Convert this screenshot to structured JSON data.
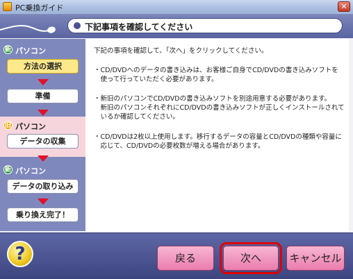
{
  "window": {
    "title": "PC乗換ガイド",
    "close_glyph": "✕"
  },
  "header": {
    "title": "下記事項を確認してください"
  },
  "sidebar": {
    "sections": [
      {
        "badge": "新",
        "label": "パソコン"
      },
      {
        "badge": "旧",
        "label": "パソコン"
      },
      {
        "badge": "新",
        "label": "パソコン"
      }
    ],
    "steps": [
      "方法の選択",
      "準備",
      "データの収集",
      "データの取り込み",
      "乗り換え完了！"
    ]
  },
  "main": {
    "paragraphs": [
      "下記の事項を確認して、「次へ」をクリックしてください。",
      "・CD/DVDへのデータの書き込みは、お客様ご自身でCD/DVDの書き込みソフトを\n　使って行っていただく必要があります。",
      "・新旧のパソコンでCD/DVDの書き込みソフトを別途用意する必要があります。\n　新旧のパソコンそれぞれにCD/DVDの書き込みソフトが正しくインストールされて\n　いるか確認してください。",
      "・CD/DVDは2枚以上使用します。移行するデータの容量とCD/DVDの種類や容量に\n　応じて、CD/DVDの必要枚数が増える場合があります。"
    ]
  },
  "footer": {
    "help_glyph": "?",
    "back_label": "戻る",
    "next_label": "次へ",
    "cancel_label": "キャンセル"
  }
}
